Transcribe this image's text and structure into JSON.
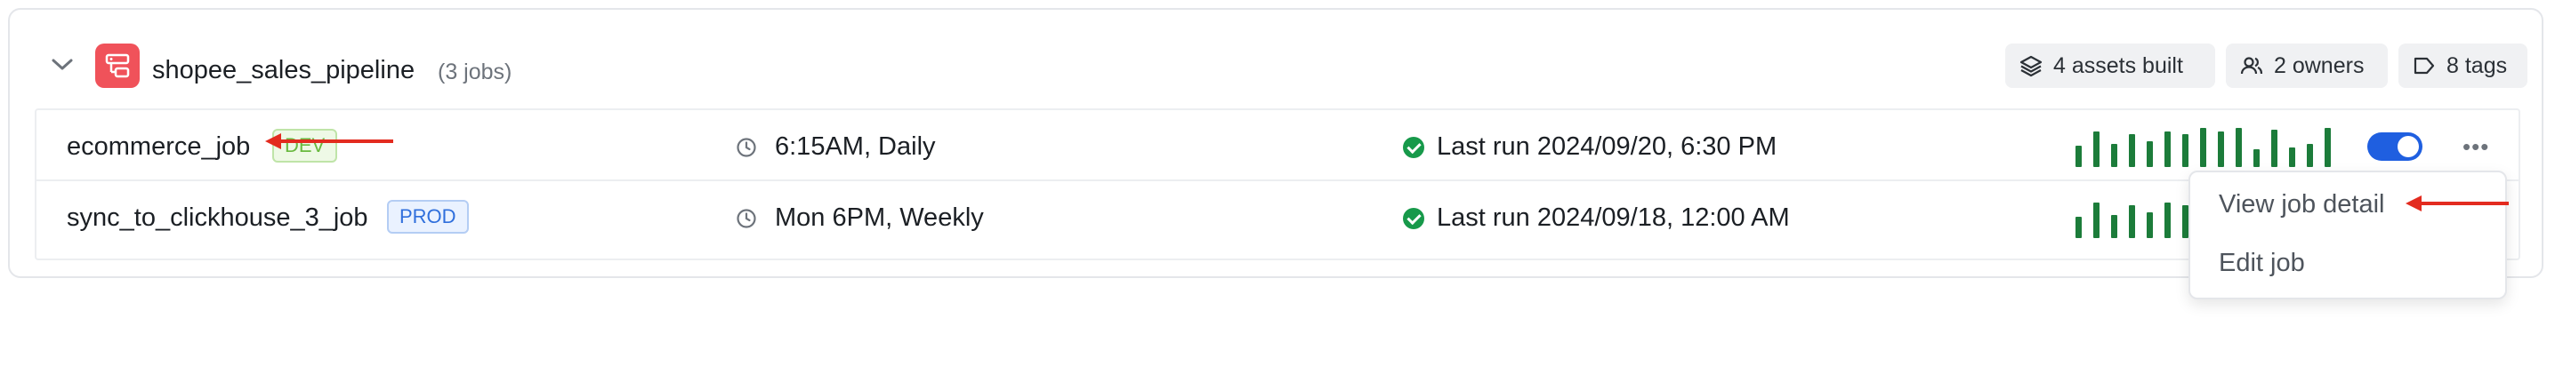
{
  "pipeline": {
    "name": "shopee_sales_pipeline",
    "job_count": "(3 jobs)",
    "chips": {
      "assets": "4 assets built",
      "owners": "2 owners",
      "tags": "8 tags"
    }
  },
  "jobs": [
    {
      "name": "ecommerce_job",
      "env_badge": "DEV",
      "schedule": "6:15AM, Daily",
      "last_run": "Last run 2024/09/20, 6:30 PM",
      "run_history": [
        0.55,
        0.9,
        0.6,
        0.85,
        0.65,
        0.9,
        0.85,
        1.0,
        0.9,
        1.0,
        0.45,
        0.95,
        0.5,
        0.6,
        1.0
      ],
      "enabled": true
    },
    {
      "name": "sync_to_clickhouse_3_job",
      "env_badge": "PROD",
      "schedule": "Mon 6PM, Weekly",
      "last_run": "Last run 2024/09/18, 12:00 AM",
      "run_history": [
        0.55,
        0.9,
        0.6,
        0.85,
        0.65,
        0.9,
        0.85,
        1.0,
        0.9,
        1.0,
        0.45,
        0.95,
        0.5,
        0.6,
        1.0
      ],
      "enabled": true
    }
  ],
  "menu": {
    "items": [
      "View job detail",
      "Edit job"
    ]
  },
  "colors": {
    "success": "#17994a",
    "sparkline": "#1c7c3a",
    "toggle_on": "#1f5fe0",
    "arrow": "#e32b1f"
  }
}
